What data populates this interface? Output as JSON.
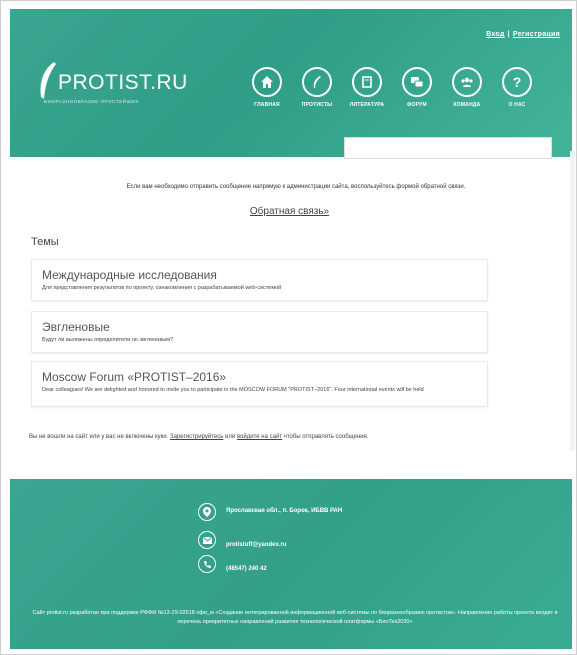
{
  "header": {
    "auth": {
      "login": "Вход",
      "separator": "|",
      "register": "Регистрация"
    },
    "logo": {
      "text": "PROTIST.RU",
      "subtitle": "БИОРАЗНООБРАЗИЕ ПРОСТЕЙШИХ"
    },
    "nav": [
      {
        "label": "ГЛАВНАЯ",
        "icon": "home-icon"
      },
      {
        "label": "ПРОТИСТЫ",
        "icon": "feather-icon"
      },
      {
        "label": "ЛИТЕРАТУРА",
        "icon": "book-icon"
      },
      {
        "label": "ФОРУМ",
        "icon": "chat-icon"
      },
      {
        "label": "КОМАНДА",
        "icon": "team-icon"
      },
      {
        "label": "О НАС",
        "icon": "question-icon"
      }
    ],
    "search": {
      "placeholder": ""
    }
  },
  "main": {
    "notice": "Если вам необходимо отправить сообщение напрямую к администрации сайта, воспользуйтесь формой обратной связи.",
    "feedback_link": "Обратная связь»",
    "topics_title": "Темы",
    "topics": [
      {
        "title": "Международные исследования",
        "description": "Для представления результатов по проекту, ознакомления с разрабатываемой web-системой"
      },
      {
        "title": "Эвгленовые",
        "description": "Будут ли выложены определители по эвгленовым?"
      },
      {
        "title": "Moscow Forum «PROTIST–2016»",
        "description": "Dear colleagues! We are delighted and honored to invite you to participate in the MOSCOW FORUM \"PROTIST–2016\". Four international events will be held"
      }
    ],
    "login_note": {
      "before": "Вы не вошли на сайт или у вас не включены куки. ",
      "register_link": "Зарегистрируйтесь",
      "middle": " или ",
      "login_link": "войдите на сайт",
      "after": " чтобы отправлять сообщения."
    }
  },
  "footer": {
    "address": "Ярославская обл., п. Борок, ИБВВ РАН",
    "email": "protistuff@yandex.ru",
    "phone": "(48547) 240 42",
    "note": "Сайт protist.ru разработан при поддержке РФФИ №13-29-02518 офи_м «Создание интегрированной информационной веб-системы по биоразнообразию протистов». Направление работы проекта входит в перечень приоритетных направлений развития технологической платформы «БиоТех2030»"
  },
  "colors": {
    "brand_green": "#3aa590",
    "text": "#444444"
  }
}
